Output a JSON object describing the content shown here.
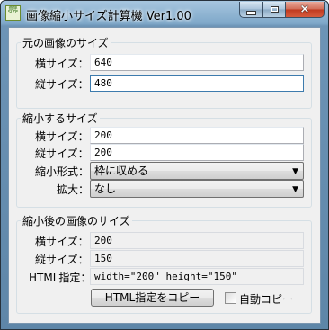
{
  "window": {
    "title": "画像縮小サイズ計算機 Ver1.00",
    "icon_glyphs": [
      "画像",
      "SIZE"
    ],
    "controls": {
      "min": "minimize-icon",
      "max": "maximize-icon",
      "close": "×"
    }
  },
  "original": {
    "title": "元の画像のサイズ",
    "width_label": "横サイズ：",
    "width_value": "640",
    "height_label": "縦サイズ：",
    "height_value": "480"
  },
  "shrink": {
    "title": "縮小するサイズ",
    "width_label": "横サイズ：",
    "width_value": "200",
    "height_label": "縦サイズ：",
    "height_value": "200",
    "mode_label": "縮小形式：",
    "mode_value": "枠に収める",
    "enlarge_label": "拡大：",
    "enlarge_value": "なし",
    "dropdown_arrow": "▼"
  },
  "result": {
    "title": "縮小後の画像のサイズ",
    "width_label": "横サイズ：",
    "width_value": "200",
    "height_label": "縦サイズ：",
    "height_value": "150",
    "html_label": "HTML指定：",
    "html_value": "width=\"200\" height=\"150\"",
    "copy_button": "HTML指定をコピー",
    "auto_copy_label": "自動コピー",
    "auto_copy_checked": false
  }
}
